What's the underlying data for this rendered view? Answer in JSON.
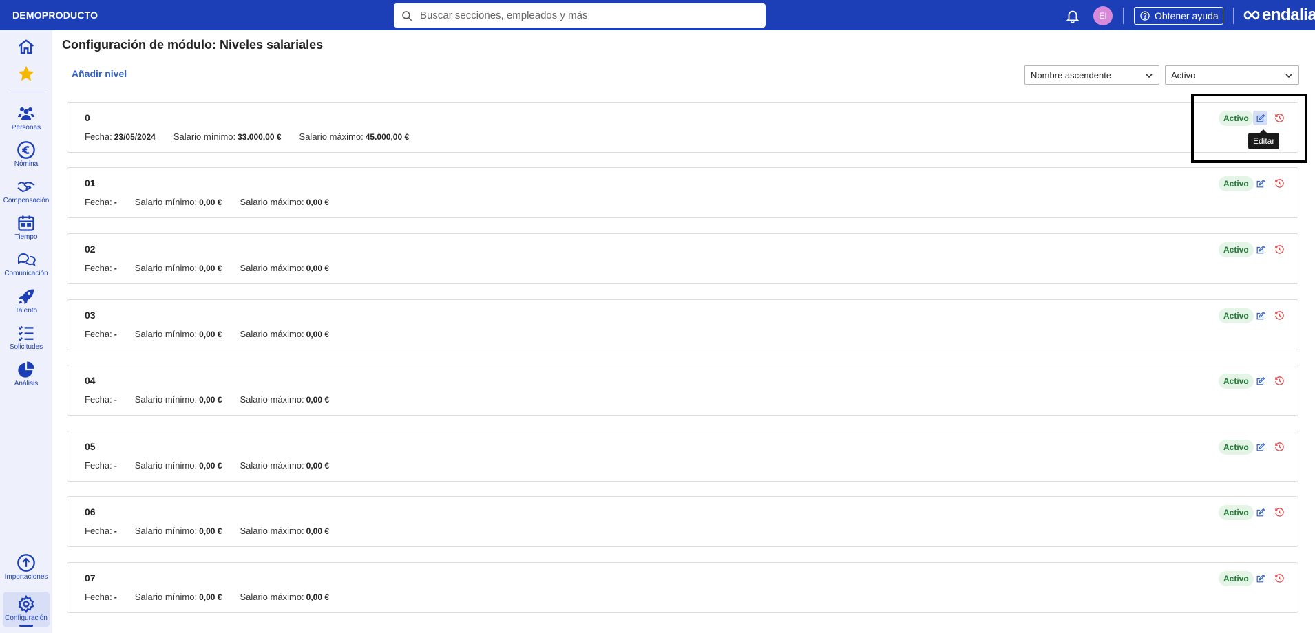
{
  "topbar": {
    "brand": "DEMOPRODUCTO",
    "search_placeholder": "Buscar secciones, empleados y más",
    "avatar_initials": "EI",
    "help_label": "Obtener ayuda",
    "logo_text": "endalia",
    "accent_color": "#1c3fb7"
  },
  "sidebar": {
    "items": [
      {
        "label": "",
        "icon": "home-icon"
      },
      {
        "label": "",
        "icon": "star-icon"
      },
      {
        "label": "Personas",
        "icon": "people-icon"
      },
      {
        "label": "Nómina",
        "icon": "euro-icon"
      },
      {
        "label": "Compensación",
        "icon": "handshake-icon"
      },
      {
        "label": "Tiempo",
        "icon": "calendar-icon"
      },
      {
        "label": "Comunicación",
        "icon": "chat-icon"
      },
      {
        "label": "Talento",
        "icon": "rocket-icon"
      },
      {
        "label": "Solicitudes",
        "icon": "checklist-icon"
      },
      {
        "label": "Análisis",
        "icon": "pie-chart-icon"
      },
      {
        "label": "Importaciones",
        "icon": "upload-icon"
      },
      {
        "label": "Configuración",
        "icon": "gear-icon"
      }
    ],
    "active": "Configuración"
  },
  "main": {
    "title": "Configuración de módulo: Niveles salariales",
    "add_link": "Añadir nivel",
    "sort_select": "Nombre ascendente",
    "status_select": "Activo",
    "labels": {
      "fecha": "Fecha:",
      "salario_min": "Salario mínimo:",
      "salario_max": "Salario máximo:"
    },
    "levels": [
      {
        "name": "0",
        "fecha": "23/05/2024",
        "min": "33.000,00 €",
        "max": "45.000,00 €",
        "status": "Activo"
      },
      {
        "name": "01",
        "fecha": "-",
        "min": "0,00 €",
        "max": "0,00 €",
        "status": "Activo"
      },
      {
        "name": "02",
        "fecha": "-",
        "min": "0,00 €",
        "max": "0,00 €",
        "status": "Activo"
      },
      {
        "name": "03",
        "fecha": "-",
        "min": "0,00 €",
        "max": "0,00 €",
        "status": "Activo"
      },
      {
        "name": "04",
        "fecha": "-",
        "min": "0,00 €",
        "max": "0,00 €",
        "status": "Activo"
      },
      {
        "name": "05",
        "fecha": "-",
        "min": "0,00 €",
        "max": "0,00 €",
        "status": "Activo"
      },
      {
        "name": "06",
        "fecha": "-",
        "min": "0,00 €",
        "max": "0,00 €",
        "status": "Activo"
      },
      {
        "name": "07",
        "fecha": "-",
        "min": "0,00 €",
        "max": "0,00 €",
        "status": "Activo"
      }
    ],
    "tooltip": "Editar"
  }
}
